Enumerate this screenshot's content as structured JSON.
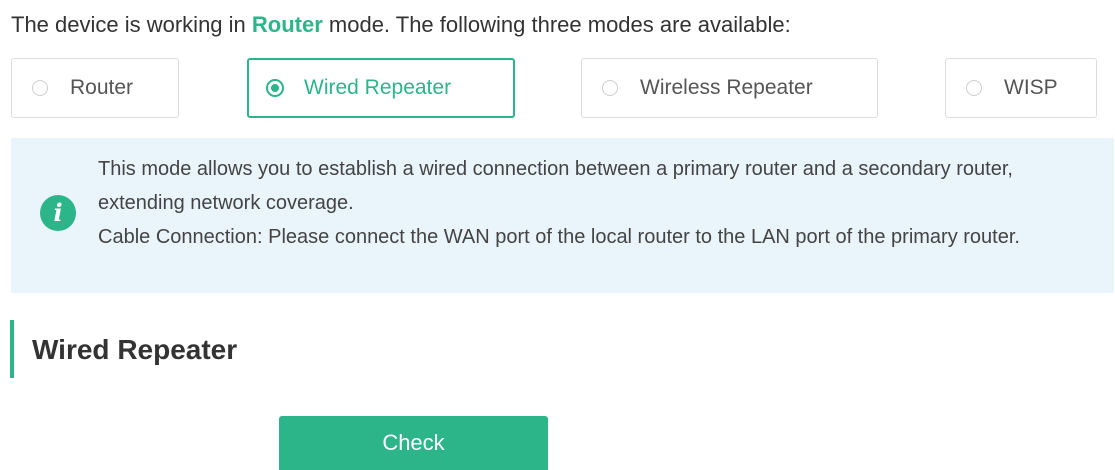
{
  "mode_sentence": {
    "prefix": "The device is working in ",
    "current_mode": "Router",
    "suffix": " mode. The following three modes are available:"
  },
  "modes": [
    {
      "label": "Router",
      "selected": false
    },
    {
      "label": "Wired Repeater",
      "selected": true
    },
    {
      "label": "Wireless Repeater",
      "selected": false
    },
    {
      "label": "WISP",
      "selected": false
    }
  ],
  "info": {
    "icon": "info-icon",
    "lines": [
      "This mode allows you to establish a wired connection between a primary router and a secondary router, extending network coverage.",
      "Cable Connection: Please connect the WAN port of the local router to the LAN port of the primary router."
    ]
  },
  "section": {
    "title": "Wired Repeater"
  },
  "check_button": {
    "label": "Check"
  },
  "colors": {
    "accent": "#2bb588",
    "info_background": "#e9f4fb",
    "text": "#333333",
    "border": "#dcdcdc"
  }
}
